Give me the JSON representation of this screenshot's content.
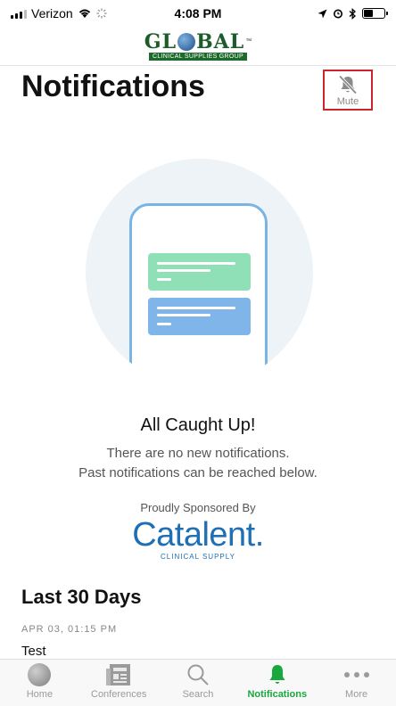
{
  "status_bar": {
    "carrier": "Verizon",
    "time": "4:08 PM"
  },
  "header": {
    "logo_text_left": "GL",
    "logo_text_right": "BAL",
    "logo_tm": "™",
    "logo_subtitle": "CLINICAL SUPPLIES GROUP"
  },
  "page": {
    "title": "Notifications",
    "mute_label": "Mute"
  },
  "empty_state": {
    "title": "All Caught Up!",
    "line1": "There are no new notifications.",
    "line2": "Past notifications can be reached below."
  },
  "sponsor": {
    "label": "Proudly Sponsored By",
    "name": "Catalent",
    "subtitle": "CLINICAL SUPPLY"
  },
  "history": {
    "section_title": "Last 30 Days",
    "items": [
      {
        "date": "APR 03, 01:15 PM",
        "text": "Test"
      }
    ]
  },
  "tabbar": {
    "tabs": [
      {
        "label": "Home",
        "icon": "globe-icon"
      },
      {
        "label": "Conferences",
        "icon": "newspaper-icon"
      },
      {
        "label": "Search",
        "icon": "search-icon"
      },
      {
        "label": "Notifications",
        "icon": "bell-icon",
        "active": true
      },
      {
        "label": "More",
        "icon": "more-icon"
      }
    ]
  },
  "colors": {
    "accent": "#19a83d",
    "mute_highlight": "#c8262a",
    "sponsor_blue": "#1f6fb5"
  }
}
